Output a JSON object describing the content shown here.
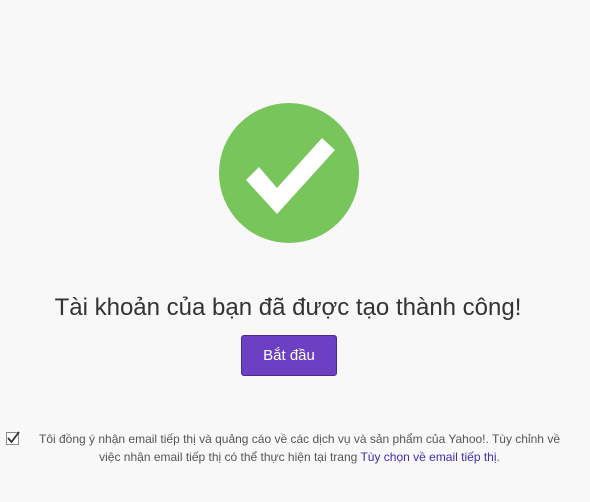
{
  "success": {
    "icon": "checkmark-icon",
    "color": "#77c55b"
  },
  "title": "Tài khoản của bạn đã được tạo thành công!",
  "start_button": {
    "label": "Bắt đầu",
    "color": "#6d3fc2"
  },
  "consent": {
    "checked": true,
    "text": "Tôi đồng ý nhận email tiếp thị và quảng cáo về các dịch vụ và sản phẩm của Yahoo!. Tùy chỉnh về việc nhận email tiếp thị có thể thực hiện tại trang ",
    "link_label": "Tùy chọn về email tiếp thị",
    "link_suffix": ".",
    "link_color": "#3d2fb0"
  }
}
